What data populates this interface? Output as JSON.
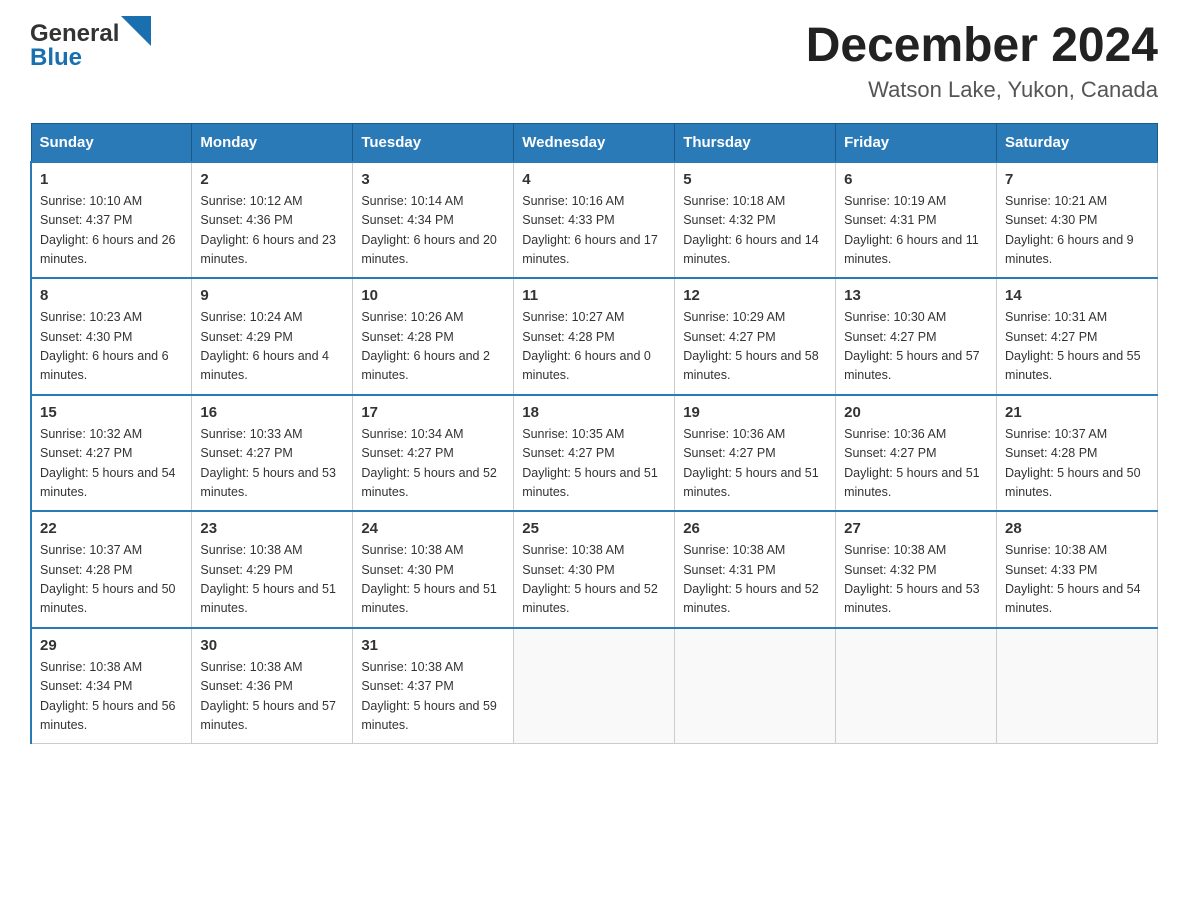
{
  "header": {
    "logo_line1": "General",
    "logo_line2": "Blue",
    "title": "December 2024",
    "subtitle": "Watson Lake, Yukon, Canada"
  },
  "days_of_week": [
    "Sunday",
    "Monday",
    "Tuesday",
    "Wednesday",
    "Thursday",
    "Friday",
    "Saturday"
  ],
  "weeks": [
    [
      {
        "day": "1",
        "sunrise": "10:10 AM",
        "sunset": "4:37 PM",
        "daylight": "6 hours and 26 minutes."
      },
      {
        "day": "2",
        "sunrise": "10:12 AM",
        "sunset": "4:36 PM",
        "daylight": "6 hours and 23 minutes."
      },
      {
        "day": "3",
        "sunrise": "10:14 AM",
        "sunset": "4:34 PM",
        "daylight": "6 hours and 20 minutes."
      },
      {
        "day": "4",
        "sunrise": "10:16 AM",
        "sunset": "4:33 PM",
        "daylight": "6 hours and 17 minutes."
      },
      {
        "day": "5",
        "sunrise": "10:18 AM",
        "sunset": "4:32 PM",
        "daylight": "6 hours and 14 minutes."
      },
      {
        "day": "6",
        "sunrise": "10:19 AM",
        "sunset": "4:31 PM",
        "daylight": "6 hours and 11 minutes."
      },
      {
        "day": "7",
        "sunrise": "10:21 AM",
        "sunset": "4:30 PM",
        "daylight": "6 hours and 9 minutes."
      }
    ],
    [
      {
        "day": "8",
        "sunrise": "10:23 AM",
        "sunset": "4:30 PM",
        "daylight": "6 hours and 6 minutes."
      },
      {
        "day": "9",
        "sunrise": "10:24 AM",
        "sunset": "4:29 PM",
        "daylight": "6 hours and 4 minutes."
      },
      {
        "day": "10",
        "sunrise": "10:26 AM",
        "sunset": "4:28 PM",
        "daylight": "6 hours and 2 minutes."
      },
      {
        "day": "11",
        "sunrise": "10:27 AM",
        "sunset": "4:28 PM",
        "daylight": "6 hours and 0 minutes."
      },
      {
        "day": "12",
        "sunrise": "10:29 AM",
        "sunset": "4:27 PM",
        "daylight": "5 hours and 58 minutes."
      },
      {
        "day": "13",
        "sunrise": "10:30 AM",
        "sunset": "4:27 PM",
        "daylight": "5 hours and 57 minutes."
      },
      {
        "day": "14",
        "sunrise": "10:31 AM",
        "sunset": "4:27 PM",
        "daylight": "5 hours and 55 minutes."
      }
    ],
    [
      {
        "day": "15",
        "sunrise": "10:32 AM",
        "sunset": "4:27 PM",
        "daylight": "5 hours and 54 minutes."
      },
      {
        "day": "16",
        "sunrise": "10:33 AM",
        "sunset": "4:27 PM",
        "daylight": "5 hours and 53 minutes."
      },
      {
        "day": "17",
        "sunrise": "10:34 AM",
        "sunset": "4:27 PM",
        "daylight": "5 hours and 52 minutes."
      },
      {
        "day": "18",
        "sunrise": "10:35 AM",
        "sunset": "4:27 PM",
        "daylight": "5 hours and 51 minutes."
      },
      {
        "day": "19",
        "sunrise": "10:36 AM",
        "sunset": "4:27 PM",
        "daylight": "5 hours and 51 minutes."
      },
      {
        "day": "20",
        "sunrise": "10:36 AM",
        "sunset": "4:27 PM",
        "daylight": "5 hours and 51 minutes."
      },
      {
        "day": "21",
        "sunrise": "10:37 AM",
        "sunset": "4:28 PM",
        "daylight": "5 hours and 50 minutes."
      }
    ],
    [
      {
        "day": "22",
        "sunrise": "10:37 AM",
        "sunset": "4:28 PM",
        "daylight": "5 hours and 50 minutes."
      },
      {
        "day": "23",
        "sunrise": "10:38 AM",
        "sunset": "4:29 PM",
        "daylight": "5 hours and 51 minutes."
      },
      {
        "day": "24",
        "sunrise": "10:38 AM",
        "sunset": "4:30 PM",
        "daylight": "5 hours and 51 minutes."
      },
      {
        "day": "25",
        "sunrise": "10:38 AM",
        "sunset": "4:30 PM",
        "daylight": "5 hours and 52 minutes."
      },
      {
        "day": "26",
        "sunrise": "10:38 AM",
        "sunset": "4:31 PM",
        "daylight": "5 hours and 52 minutes."
      },
      {
        "day": "27",
        "sunrise": "10:38 AM",
        "sunset": "4:32 PM",
        "daylight": "5 hours and 53 minutes."
      },
      {
        "day": "28",
        "sunrise": "10:38 AM",
        "sunset": "4:33 PM",
        "daylight": "5 hours and 54 minutes."
      }
    ],
    [
      {
        "day": "29",
        "sunrise": "10:38 AM",
        "sunset": "4:34 PM",
        "daylight": "5 hours and 56 minutes."
      },
      {
        "day": "30",
        "sunrise": "10:38 AM",
        "sunset": "4:36 PM",
        "daylight": "5 hours and 57 minutes."
      },
      {
        "day": "31",
        "sunrise": "10:38 AM",
        "sunset": "4:37 PM",
        "daylight": "5 hours and 59 minutes."
      },
      null,
      null,
      null,
      null
    ]
  ]
}
